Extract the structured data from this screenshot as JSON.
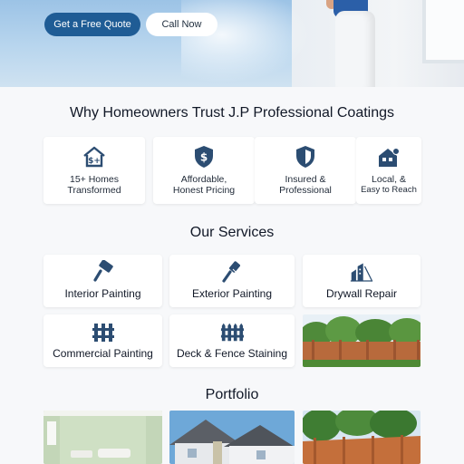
{
  "hero": {
    "quote_label": "Get a Free Quote",
    "call_label": "Call Now"
  },
  "trust": {
    "title": "Why Homeowners Trust J.P Professional Coatings",
    "cards": [
      {
        "icon": "home-dollar-icon",
        "line1": "15+ Homes",
        "line2": "Transformed"
      },
      {
        "icon": "dollar-shield-icon",
        "line1": "Affordable,",
        "line2": "Honest Pricing"
      },
      {
        "icon": "shield-icon",
        "line1": "Insured &",
        "line2": "Professional"
      },
      {
        "icon": "house-location-icon",
        "line1": "Local, &",
        "line2": "Easy to Reach"
      }
    ]
  },
  "services": {
    "title": "Our Services",
    "items": [
      {
        "icon": "paint-roller-icon",
        "label": "Interior Painting"
      },
      {
        "icon": "paint-brush-icon",
        "label": "Exterior Painting"
      },
      {
        "icon": "building-icon",
        "label": "Drywall Repair"
      },
      {
        "icon": "fence-icon",
        "label": "Commercial Painting"
      },
      {
        "icon": "fence-icon",
        "label": "Deck & Fence Staining"
      }
    ]
  },
  "portfolio": {
    "title": "Portfolio"
  },
  "colors": {
    "brand_blue": "#1f5c95",
    "icon_navy": "#2c4d72"
  }
}
